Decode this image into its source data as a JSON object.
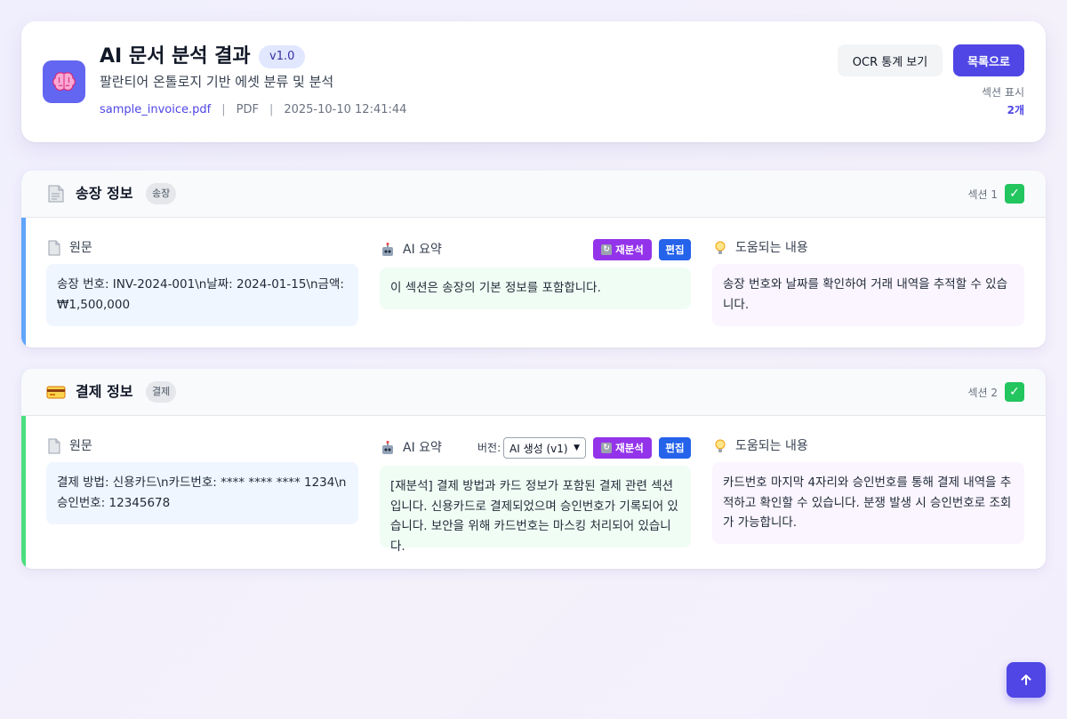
{
  "header": {
    "title": "AI 문서 분석 결과",
    "version": "v1.0",
    "subtitle": "팔란티어 온톨로지 기반 에셋 분류 및 분석",
    "file_name": "sample_invoice.pdf",
    "file_type": "PDF",
    "timestamp": "2025-10-10 12:41:44",
    "ocr_button": "OCR 통계 보기",
    "list_button": "목록으로",
    "section_display_label": "섹션 표시",
    "section_count": "2개",
    "logo_icon": "brain-icon"
  },
  "sections": [
    {
      "title": "송장 정보",
      "tag": "송장",
      "number": "섹션 1",
      "accent": "#60a5fa",
      "icon": "document-icon",
      "original_label": "원문",
      "original_text": "송장 번호: INV-2024-001\\n날짜: 2024-01-15\\n금액: ₩1,500,000",
      "ai_label": "AI 요약",
      "ai_text": "이 섹션은 송장의 기본 정보를 포함합니다.",
      "reanalyze": "재분석",
      "edit": "편집",
      "help_label": "도움되는 내용",
      "help_text": "송장 번호와 날짜를 확인하여 거래 내역을 추적할 수 있습니다."
    },
    {
      "title": "결제 정보",
      "tag": "결제",
      "number": "섹션 2",
      "accent": "#4ade80",
      "icon": "credit-card-icon",
      "original_label": "원문",
      "original_text": "결제 방법: 신용카드\\n카드번호: **** **** **** 1234\\n승인번호: 12345678",
      "ai_label": "AI 요약",
      "version_label": "버전:",
      "version_value": "AI 생성 (v1)",
      "ai_text": "[재분석] 결제 방법과 카드 정보가 포함된 결제 관련 섹션입니다. 신용카드로 결제되었으며 승인번호가 기록되어 있습니다. 보안을 위해 카드번호는 마스킹 처리되어 있습니다.",
      "reanalyze": "재분석",
      "edit": "편집",
      "help_label": "도움되는 내용",
      "help_text": "카드번호 마지막 4자리와 승인번호를 통해 결제 내역을 추적하고 확인할 수 있습니다. 분쟁 발생 시 승인번호로 조회가 가능합니다."
    }
  ],
  "colors": {
    "primary": "#4f46e5",
    "reanalyze": "#9333ea",
    "edit": "#2563eb",
    "check": "#22c55e"
  },
  "scroll_top_icon": "arrow-up-icon"
}
